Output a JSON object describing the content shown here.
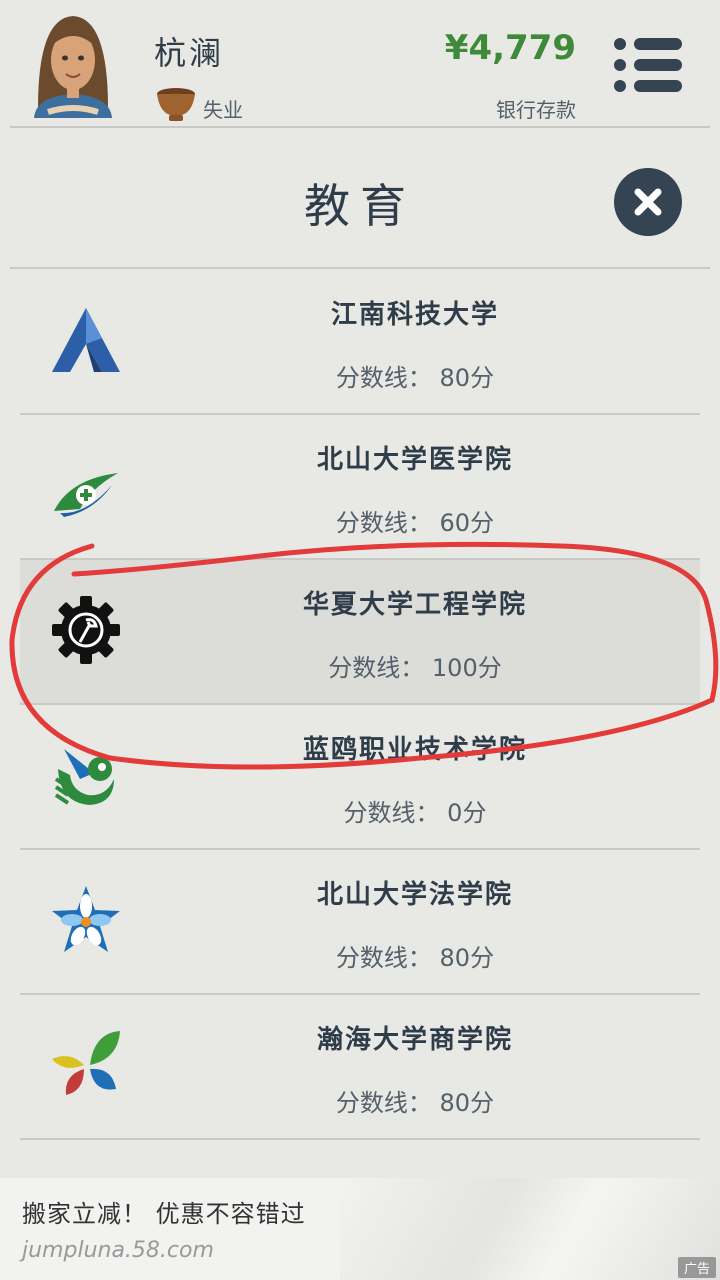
{
  "header": {
    "player_name": "杭澜",
    "status": "失业",
    "money": "¥4,779",
    "money_label": "银行存款"
  },
  "page": {
    "title": "教育"
  },
  "schools": [
    {
      "name": "江南科技大学",
      "score": "分数线： 80分",
      "icon": "triangle-logo-icon"
    },
    {
      "name": "北山大学医学院",
      "score": "分数线： 60分",
      "icon": "medical-cross-logo-icon"
    },
    {
      "name": "华夏大学工程学院",
      "score": "分数线： 100分",
      "icon": "gear-wrench-icon",
      "selected": true
    },
    {
      "name": "蓝鸥职业技术学院",
      "score": "分数线： 0分",
      "icon": "bird-logo-icon"
    },
    {
      "name": "北山大学法学院",
      "score": "分数线： 80分",
      "icon": "star-flower-logo-icon"
    },
    {
      "name": "瀚海大学商学院",
      "score": "分数线： 80分",
      "icon": "leaves-logo-icon"
    }
  ],
  "ad": {
    "text": "搬家立减！ 优惠不容错过",
    "url": "jumpluna.58.com",
    "badge": "广告"
  },
  "colors": {
    "accent_dark": "#354452",
    "money_green": "#3f8a3a",
    "annotation_red": "#e33a3a"
  }
}
